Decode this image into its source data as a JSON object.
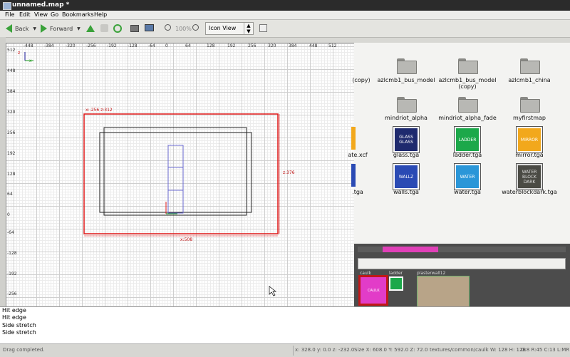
{
  "window": {
    "title": "unnamed.map *"
  },
  "menu": [
    "File",
    "Edit",
    "View",
    "Go",
    "Bookmarks",
    "Help"
  ],
  "toolbar": {
    "back_label": "Back",
    "forward_label": "Forward",
    "zoom_label": "100%",
    "view_mode": "Icon View"
  },
  "grid": {
    "x_ticks": [
      "-448",
      "-384",
      "-320",
      "-256",
      "-192",
      "-128",
      "-64",
      "0",
      "64",
      "128",
      "192",
      "256",
      "320",
      "384",
      "448",
      "512"
    ],
    "y_ticks": [
      "512",
      "448",
      "384",
      "320",
      "256",
      "192",
      "128",
      "64",
      "0",
      "-64",
      "-128",
      "-192",
      "-256"
    ],
    "axis_x": "x",
    "axis_z": "z",
    "coord_label": "x:-256  z:312",
    "height_label": "z:376",
    "width_label": "x:508"
  },
  "files": {
    "row1": [
      "(copy)",
      "azlcmb1_bus_model",
      "azlcmb1_bus_model\n(copy)",
      "azlcmb1_china"
    ],
    "row2": [
      "mindriot_alpha",
      "mindriot_alpha_fade",
      "myfirstmap"
    ],
    "row3": [
      {
        "name": "ate.xcf",
        "thumb": ""
      },
      {
        "name": "glass.tga",
        "thumb": "GLASS GLASS"
      },
      {
        "name": "ladder.tga",
        "thumb": "LADDER"
      },
      {
        "name": "mirror.tga",
        "thumb": "MIRROR"
      }
    ],
    "row4": [
      {
        "name": ".tga",
        "thumb": ""
      },
      {
        "name": "walls.tga",
        "thumb": "WALLZ"
      },
      {
        "name": "water.tga",
        "thumb": "WATER"
      },
      {
        "name": "waterblockdark.tga",
        "thumb": "WATER BLOCK DARK"
      }
    ],
    "colors": {
      "glass": "#1e2a6e",
      "ladder": "#1ca84a",
      "mirror": "#f2a81c",
      "walls": "#2a4ab4",
      "water": "#2a96d8",
      "waterblock": "#4a4a44"
    }
  },
  "textures": {
    "items": [
      "caulk",
      "ladder",
      "plasterwall12"
    ],
    "selected_thumb": "CAULK"
  },
  "console": {
    "lines": [
      "Hit edge",
      "Hit edge",
      "Side stretch",
      "Side stretch"
    ]
  },
  "status": {
    "message": "Drag completed.",
    "coords": "x: 328.0  y: 0.0  z: -232.0",
    "size": "Size X: 608.0  Y: 592.0  Z: 72.0",
    "texture": "textures/common/caulk",
    "dims": "W: 128 H: 128",
    "grid": "G:8 R:45 C:13 L:MR"
  }
}
